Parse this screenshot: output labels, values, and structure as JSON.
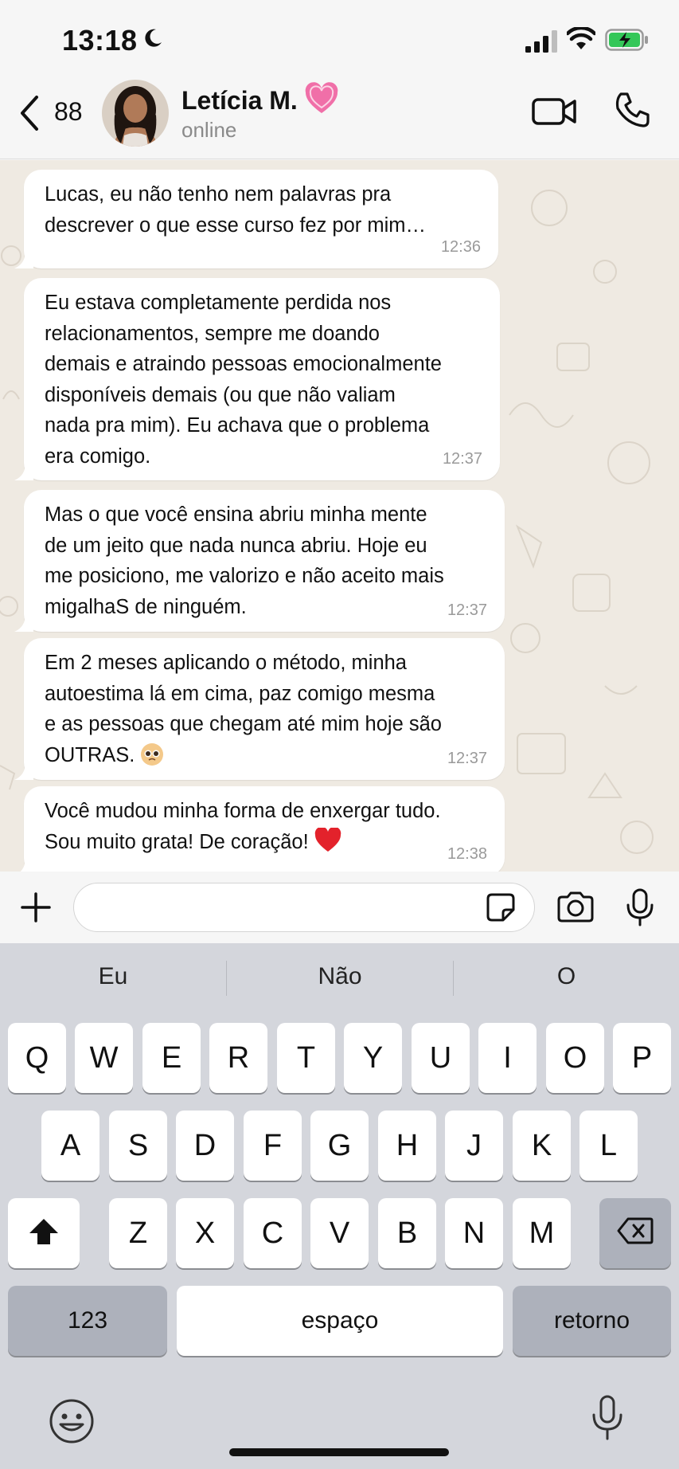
{
  "status_bar": {
    "time": "13:18"
  },
  "header": {
    "back_count": "88",
    "contact_name": "Letícia M.",
    "contact_status": "online"
  },
  "messages": [
    {
      "text": "Lucas, eu não tenho nem palavras pra\ndescrever o que esse curso fez por mim…",
      "time": "12:36"
    },
    {
      "text": "Eu estava completamente perdida nos\nrelacionamentos, sempre me doando\ndemais e atraindo pessoas emocionalmente\ndisponíveis demais (ou que não valiam\nnada pra mim). Eu achava que o problema\nera comigo.",
      "time": "12:37"
    },
    {
      "text": "Mas o que você ensina abriu minha mente\nde um jeito que nada nunca abriu. Hoje eu\nme posiciono, me valorizo e não aceito mais\nmigalhaS de ninguém.",
      "time": "12:37"
    },
    {
      "text": "Em 2 meses aplicando o método, minha\nautoestima lá em cima, paz comigo mesma\ne as pessoas que chegam até mim hoje são\nOUTRAS.",
      "time": "12:37",
      "emoji": "pleading-face"
    },
    {
      "text": "Você mudou minha forma de enxergar tudo.\nSou muito grata! De coração!",
      "time": "12:38",
      "emoji": "red-heart"
    }
  ],
  "input": {
    "value": "",
    "placeholder": ""
  },
  "keyboard": {
    "suggestions": [
      "Eu",
      "Não",
      "O"
    ],
    "row1": [
      "Q",
      "W",
      "E",
      "R",
      "T",
      "Y",
      "U",
      "I",
      "O",
      "P"
    ],
    "row2": [
      "A",
      "S",
      "D",
      "F",
      "G",
      "H",
      "J",
      "K",
      "L"
    ],
    "row3": [
      "Z",
      "X",
      "C",
      "V",
      "B",
      "N",
      "M"
    ],
    "numbers_label": "123",
    "space_label": "espaço",
    "return_label": "retorno"
  },
  "colors": {
    "chat_background": "#efeae2",
    "bubble": "#ffffff",
    "keyboard": "#d4d6dc",
    "battery_green": "#34c759"
  }
}
